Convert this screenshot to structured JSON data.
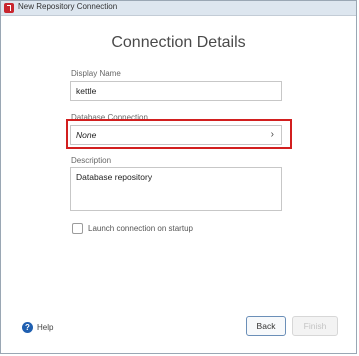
{
  "window": {
    "title": "New Repository Connection"
  },
  "dialog": {
    "heading": "Connection Details",
    "display_name": {
      "label": "Display Name",
      "value": "kettle"
    },
    "database_connection": {
      "label": "Database Connection",
      "value": "None"
    },
    "description": {
      "label": "Description",
      "value": "Database repository"
    },
    "launch_on_startup": {
      "label": "Launch connection on startup",
      "checked": false
    }
  },
  "footer": {
    "help_label": "Help",
    "back_label": "Back",
    "finish_label": "Finish"
  },
  "colors": {
    "highlight": "#d21f1f",
    "help_icon": "#1f5fb0"
  }
}
